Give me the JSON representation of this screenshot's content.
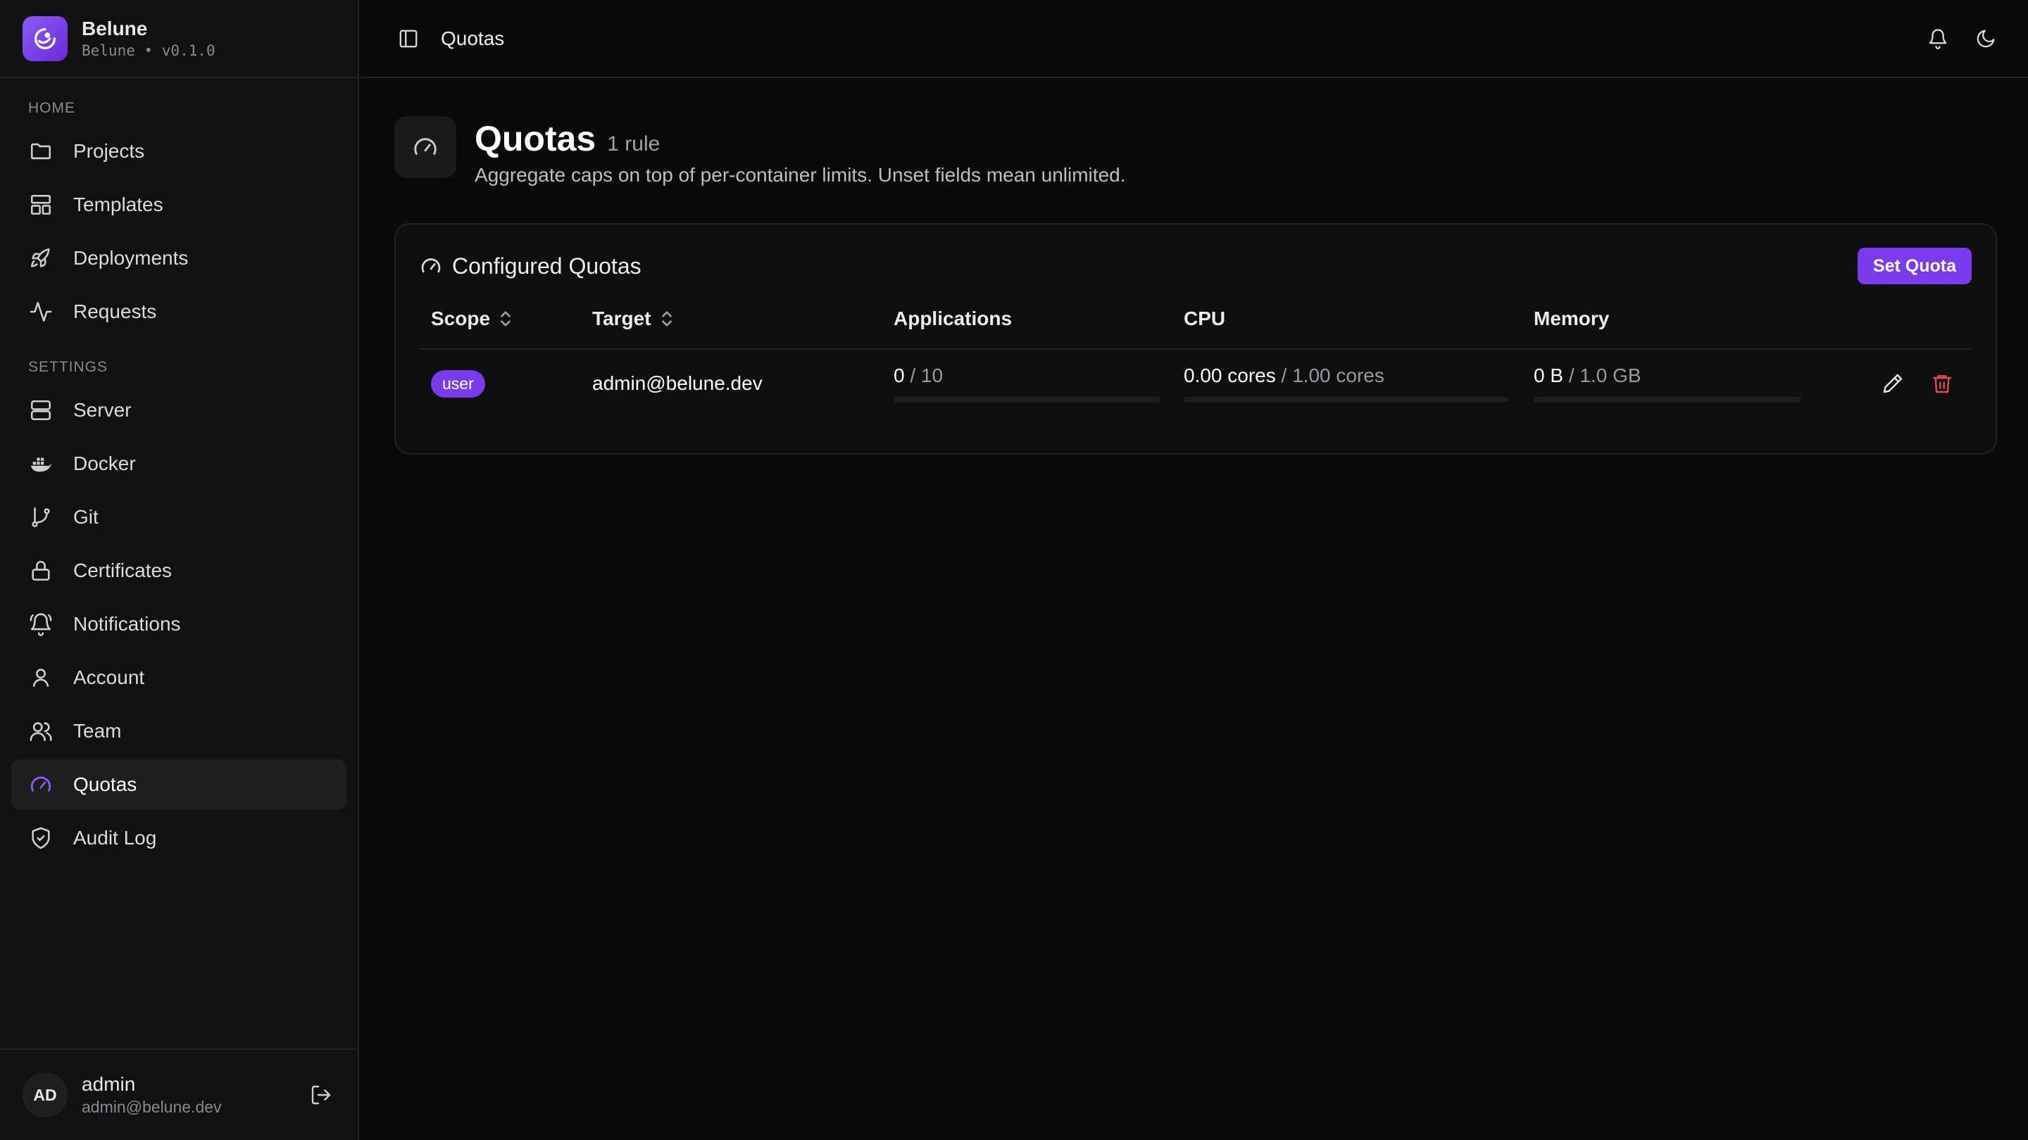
{
  "brand": {
    "name": "Belune",
    "subtitle": "Belune • v0.1.0"
  },
  "nav": {
    "home_label": "HOME",
    "settings_label": "SETTINGS",
    "home_items": [
      {
        "label": "Projects",
        "icon": "folder-icon"
      },
      {
        "label": "Templates",
        "icon": "layout-icon"
      },
      {
        "label": "Deployments",
        "icon": "rocket-icon"
      },
      {
        "label": "Requests",
        "icon": "activity-icon"
      }
    ],
    "settings_items": [
      {
        "label": "Server",
        "icon": "server-icon"
      },
      {
        "label": "Docker",
        "icon": "docker-icon"
      },
      {
        "label": "Git",
        "icon": "git-branch-icon"
      },
      {
        "label": "Certificates",
        "icon": "lock-icon"
      },
      {
        "label": "Notifications",
        "icon": "bell-ring-icon"
      },
      {
        "label": "Account",
        "icon": "user-icon"
      },
      {
        "label": "Team",
        "icon": "users-icon"
      },
      {
        "label": "Quotas",
        "icon": "gauge-icon",
        "active": true
      },
      {
        "label": "Audit Log",
        "icon": "shield-check-icon"
      }
    ]
  },
  "user": {
    "initials": "AD",
    "name": "admin",
    "email": "admin@belune.dev"
  },
  "topbar": {
    "breadcrumb": "Quotas"
  },
  "page": {
    "title": "Quotas",
    "count": "1 rule",
    "description": "Aggregate caps on top of per-container limits. Unset fields mean unlimited."
  },
  "card": {
    "title": "Configured Quotas",
    "set_button": "Set Quota",
    "columns": [
      "Scope",
      "Target",
      "Applications",
      "CPU",
      "Memory"
    ],
    "rows": [
      {
        "scope": "user",
        "target": "admin@belune.dev",
        "apps_used": "0",
        "apps_limit": "/ 10",
        "apps_fraction": 0,
        "cpu_used": "0.00 cores",
        "cpu_limit": "/ 1.00 cores",
        "cpu_fraction": 0,
        "mem_used": "0 B",
        "mem_limit": "/ 1.0 GB",
        "mem_fraction": 0
      }
    ]
  },
  "colors": {
    "accent": "#7c3aed",
    "danger": "#e5484d"
  }
}
